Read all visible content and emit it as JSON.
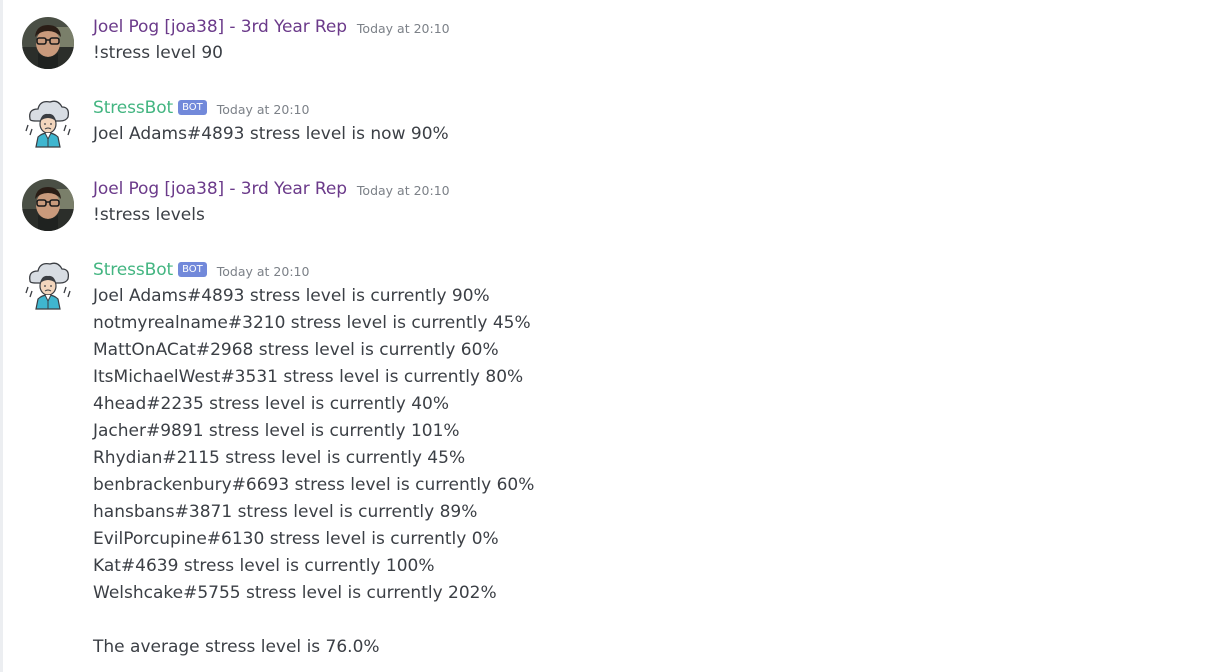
{
  "colors": {
    "joel_username": "#6b3a8a",
    "bot_username": "#43b581",
    "bot_tag_bg": "#7289da",
    "timestamp": "#7c8188",
    "text": "#3b3f45"
  },
  "messages": [
    {
      "author": "Joel Pog [joa38] - 3rd Year Rep",
      "timestamp": "Today at 20:10",
      "avatar_icon": "user-photo-avatar",
      "lines": [
        "!stress level 90"
      ]
    },
    {
      "author": "StressBot",
      "bot_tag": "BOT",
      "timestamp": "Today at 20:10",
      "avatar_icon": "rain-cloud-person-avatar",
      "lines": [
        "Joel Adams#4893 stress level is now 90%"
      ]
    },
    {
      "author": "Joel Pog [joa38] - 3rd Year Rep",
      "timestamp": "Today at 20:10",
      "avatar_icon": "user-photo-avatar",
      "lines": [
        "!stress levels"
      ]
    },
    {
      "author": "StressBot",
      "bot_tag": "BOT",
      "timestamp": "Today at 20:10",
      "avatar_icon": "rain-cloud-person-avatar",
      "lines": [
        "Joel Adams#4893 stress level is currently 90%",
        "notmyrealname#3210 stress level is currently 45%",
        "MattOnACat#2968 stress level is currently 60%",
        "ItsMichaelWest#3531 stress level is currently 80%",
        "4head#2235 stress level is currently 40%",
        "Jacher#9891 stress level is currently 101%",
        "Rhydian#2115 stress level is currently 45%",
        "benbrackenbury#6693 stress level is currently 60%",
        "hansbans#3871 stress level is currently 89%",
        "EvilPorcupine#6130 stress level is currently 0%",
        "Kat#4639 stress level is currently 100%",
        "Welshcake#5755 stress level is currently 202%",
        "",
        "The average stress level is 76.0%"
      ]
    }
  ]
}
